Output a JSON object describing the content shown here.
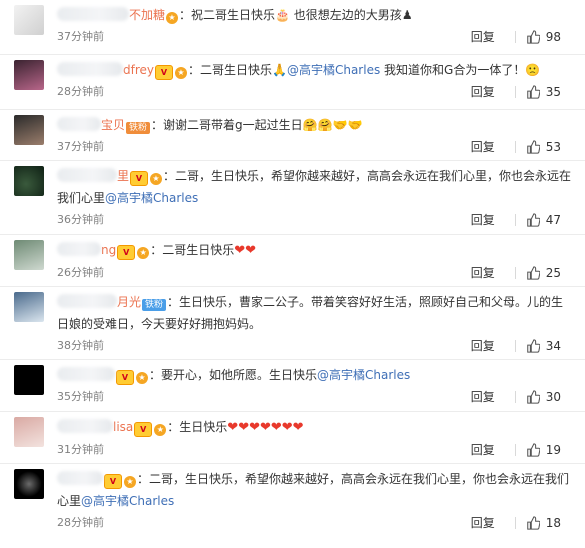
{
  "comments": [
    {
      "name_visible": "不加糖",
      "badge": "vip",
      "fan_label": "",
      "text": "：祝二哥生日快乐",
      "emoji_after": "🎂",
      "text2": " 也很想左边的大男孩",
      "emoji2": "♟",
      "mention": "",
      "time": "37分钟前",
      "reply": "回复",
      "likes": "98",
      "avatar_colors": [
        "#f2f2f2",
        "#d0d0d0"
      ]
    },
    {
      "name_visible": "dfrey",
      "badge": "v",
      "fan_label": "",
      "text": "：二哥生日快乐",
      "emoji_after": "🙏",
      "text2": "",
      "emoji2": "",
      "mention": "@高宇橘Charles",
      "text3": " 我知道你和G合为一体了！",
      "emoji3": "🙁",
      "time": "28分钟前",
      "reply": "回复",
      "likes": "35",
      "avatar_colors": [
        "#3a2330",
        "#b8668a"
      ]
    },
    {
      "name_visible": "宝贝",
      "badge": "",
      "fan_label": "铁粉",
      "fan_color": "#f08d3a",
      "text": "：谢谢二哥带着g一起过生日",
      "emoji_after": "🤗🤗🤝🤝",
      "time": "37分钟前",
      "reply": "回复",
      "likes": "53",
      "avatar_colors": [
        "#2a2a2a",
        "#9b7e6c"
      ]
    },
    {
      "name_visible": "里",
      "badge": "v",
      "fan_label": "",
      "text": "：二哥，生日快乐，希望你越来越好，高高会永远在我们心里，你也会永远在我们心里",
      "mention": "@高宇橘Charles",
      "time": "36分钟前",
      "reply": "回复",
      "likes": "47",
      "avatar_colors": [
        "#0e1f14",
        "#3a5a3c"
      ]
    },
    {
      "name_visible": "ng",
      "badge": "v",
      "fan_label": "",
      "text": "：二哥生日快乐",
      "hearts": "❤❤",
      "time": "26分钟前",
      "reply": "回复",
      "likes": "25",
      "avatar_colors": [
        "#6e8a74",
        "#cfd9d0"
      ]
    },
    {
      "name_visible": "月光",
      "badge": "",
      "fan_label": "铁粉",
      "fan_color": "#4a9ee8",
      "text": "：生日快乐，曹家二公子。带着笑容好好生活，照顾好自己和父母。儿的生日娘的受难日，今天要好好拥抱妈妈。",
      "time": "38分钟前",
      "reply": "回复",
      "likes": "34",
      "avatar_colors": [
        "#4a6a8c",
        "#dbe6ef"
      ]
    },
    {
      "name_visible": "",
      "badge": "v",
      "fan_label": "",
      "text": "：要开心，如他所愿。生日快乐",
      "mention": "@高宇橘Charles",
      "time": "35分钟前",
      "reply": "回复",
      "likes": "30",
      "avatar_colors": [
        "#000000",
        "#222222"
      ]
    },
    {
      "name_visible": "lisa",
      "badge": "v",
      "fan_label": "",
      "text": "：生日快乐",
      "hearts": "❤❤❤❤❤❤❤",
      "time": "31分钟前",
      "reply": "回复",
      "likes": "19",
      "avatar_colors": [
        "#d9a9a3",
        "#f3e3df"
      ]
    },
    {
      "name_visible": "",
      "badge": "v",
      "fan_label": "",
      "text": "：二哥，生日快乐，希望你越来越好，高高会永远在我们心里，你也会永远在我们心里",
      "mention": "@高宇橘Charles",
      "time": "28分钟前",
      "reply": "回复",
      "likes": "18",
      "avatar_colors": [
        "#000000",
        "#6b6b6b"
      ]
    }
  ]
}
